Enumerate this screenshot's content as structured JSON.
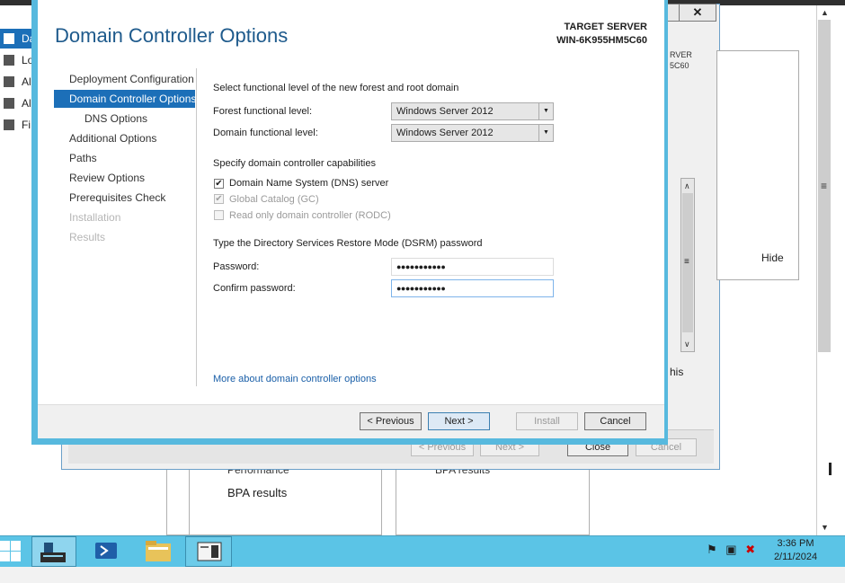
{
  "background": {
    "nav_items": [
      {
        "label": "Da"
      },
      {
        "label": "Lo"
      },
      {
        "label": "Al"
      },
      {
        "label": "Al"
      },
      {
        "label": "Fi"
      }
    ],
    "tile_texts": {
      "performance": "Performance",
      "bpa_results_1": "BPA results",
      "bpa_results_2": "BPA results"
    },
    "back_dialog": {
      "close_label": "✕",
      "target_fragment_1": "RVER",
      "target_fragment_2": "5C60",
      "hide_label": "Hide",
      "fragment_his": "his",
      "buttons": {
        "previous": "< Previous",
        "next": "Next >",
        "close": "Close",
        "cancel": "Cancel"
      }
    }
  },
  "dialog": {
    "title": "Domain Controller Options",
    "target_server_label": "TARGET SERVER",
    "target_server_name": "WIN-6K955HM5C60",
    "nav": [
      {
        "label": "Deployment Configuration",
        "state": "normal"
      },
      {
        "label": "Domain Controller Options",
        "state": "selected"
      },
      {
        "label": "DNS Options",
        "state": "sub"
      },
      {
        "label": "Additional Options",
        "state": "normal"
      },
      {
        "label": "Paths",
        "state": "normal"
      },
      {
        "label": "Review Options",
        "state": "normal"
      },
      {
        "label": "Prerequisites Check",
        "state": "normal"
      },
      {
        "label": "Installation",
        "state": "disabled"
      },
      {
        "label": "Results",
        "state": "disabled"
      }
    ],
    "functional_level_heading": "Select functional level of the new forest and root domain",
    "forest_level_label": "Forest functional level:",
    "forest_level_value": "Windows Server 2012",
    "domain_level_label": "Domain functional level:",
    "domain_level_value": "Windows Server 2012",
    "capabilities_heading": "Specify domain controller capabilities",
    "capabilities": [
      {
        "label": "Domain Name System (DNS) server",
        "checked": true,
        "enabled": true
      },
      {
        "label": "Global Catalog (GC)",
        "checked": true,
        "enabled": false
      },
      {
        "label": "Read only domain controller (RODC)",
        "checked": false,
        "enabled": false
      }
    ],
    "dsrm_heading": "Type the Directory Services Restore Mode (DSRM) password",
    "password_label": "Password:",
    "password_value": "●●●●●●●●●●●",
    "confirm_label": "Confirm password:",
    "confirm_value": "●●●●●●●●●●●",
    "more_link": "More about domain controller options",
    "buttons": {
      "previous": "< Previous",
      "next": "Next >",
      "install": "Install",
      "cancel": "Cancel"
    }
  },
  "taskbar": {
    "icons": [
      "start-icon",
      "server-manager-icon",
      "powershell-icon",
      "file-explorer-icon",
      "ad-admin-center-icon"
    ],
    "tray_icons": [
      "flag-icon",
      "network-icon",
      "volume-muted-icon"
    ],
    "time": "3:36 PM",
    "date": "2/11/2024"
  },
  "colors": {
    "accent": "#1c6fb8",
    "dialog_border": "#57b9de",
    "taskbar": "#5bc4e6",
    "title": "#1e5a8c",
    "link": "#1a5fa8"
  }
}
